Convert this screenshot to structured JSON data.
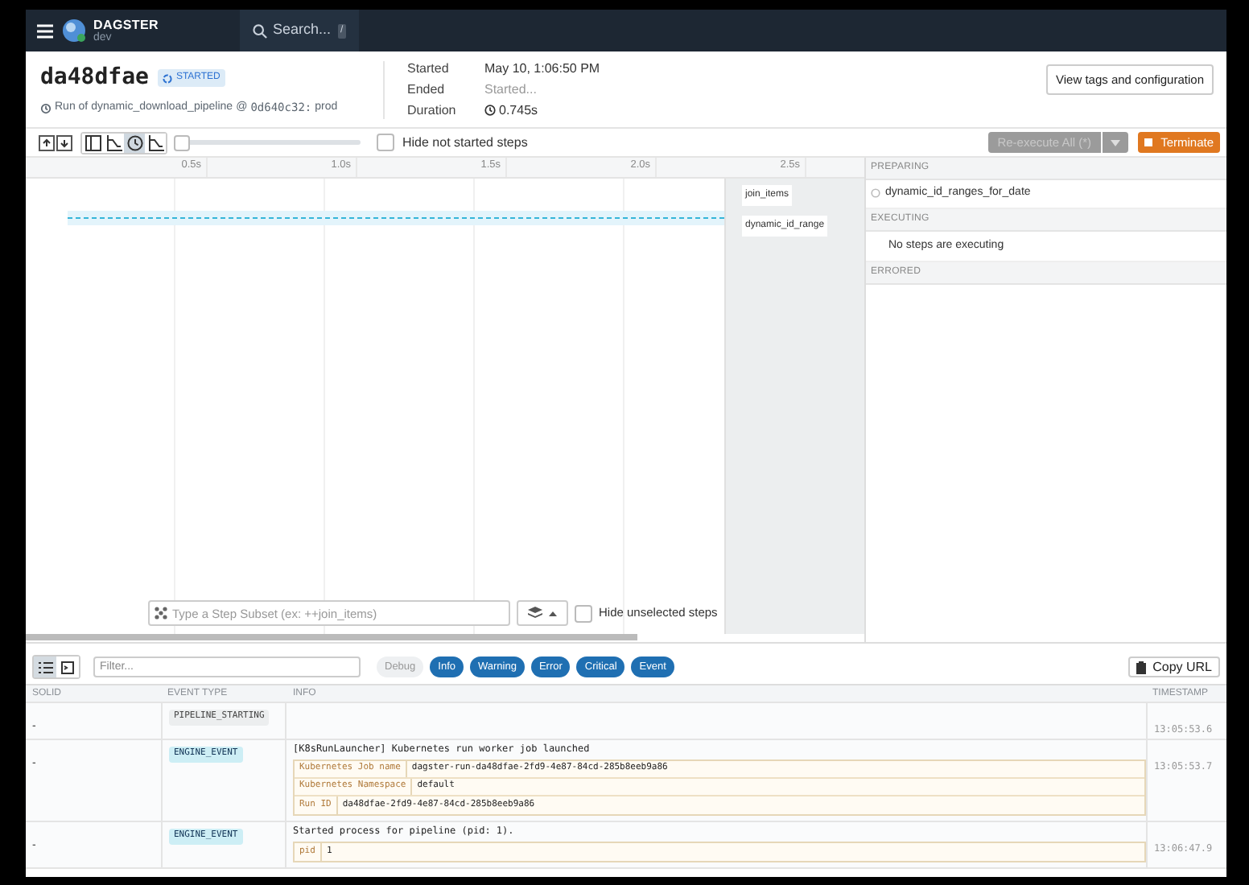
{
  "topbar": {
    "brand": "DAGSTER",
    "env": "dev",
    "search_placeholder": "Search...",
    "search_key": "/"
  },
  "run": {
    "id": "da48dfae",
    "status": "STARTED",
    "prefix": "Run of",
    "pipeline": "dynamic_download_pipeline",
    "at": "@",
    "snapshot": "0d640c32:",
    "mode": "prod"
  },
  "times": [
    {
      "label": "Started",
      "value": "May 10, 1:06:50 PM",
      "kind": "text"
    },
    {
      "label": "Ended",
      "value": "Started...",
      "kind": "muted"
    },
    {
      "label": "Duration",
      "value": "0.745s",
      "kind": "clock"
    }
  ],
  "view_button": "View tags and configuration",
  "toolbar": {
    "view_modes": [
      {
        "kind": "flat",
        "selected": false
      },
      {
        "kind": "waterfall",
        "selected": false
      },
      {
        "kind": "clock",
        "selected": true
      },
      {
        "kind": "waterfall",
        "selected": false
      }
    ],
    "zoom": {
      "level": 0.02
    },
    "hide_not_started": {
      "label": "Hide not started steps",
      "checked": false
    },
    "reexecute": {
      "label": "Re-execute All (*)",
      "disabled": true
    },
    "terminate": "Terminate"
  },
  "gantt": {
    "ticks": [
      "0.5s",
      "1.0s",
      "1.5s",
      "2.0s",
      "2.5s"
    ],
    "steps": [
      "join_items",
      "dynamic_id_range"
    ],
    "subset_placeholder": "Type a Step Subset (ex: ++join_items)",
    "hide_unselected": {
      "label": "Hide unselected steps",
      "checked": false
    }
  },
  "sections": [
    {
      "title": "PREPARING",
      "items": [
        "dynamic_id_ranges_for_date"
      ]
    },
    {
      "title": "EXECUTING",
      "empty": "No steps are executing"
    },
    {
      "title": "ERRORED"
    }
  ],
  "logs": {
    "filter_placeholder": "Filter...",
    "levels": [
      {
        "label": "Debug",
        "selected": false
      },
      {
        "label": "Info",
        "selected": true
      },
      {
        "label": "Warning",
        "selected": true
      },
      {
        "label": "Error",
        "selected": true
      },
      {
        "label": "Critical",
        "selected": true
      },
      {
        "label": "Event",
        "selected": true
      }
    ],
    "copy_url": "Copy URL",
    "columns": [
      "SOLID",
      "EVENT TYPE",
      "INFO",
      "TIMESTAMP"
    ],
    "rows": [
      {
        "solid": "-",
        "event": "PIPELINE_STARTING",
        "kind": "pipeline",
        "timestamp": "13:05:53.6"
      },
      {
        "solid": "-",
        "event": "ENGINE_EVENT",
        "kind": "engine",
        "message": "[K8sRunLauncher] Kubernetes run worker job launched",
        "metadata": [
          {
            "key": "Kubernetes Job name",
            "value": "dagster-run-da48dfae-2fd9-4e87-84cd-285b8eeb9a86"
          },
          {
            "key": "Kubernetes Namespace",
            "value": "default"
          },
          {
            "key": "Run ID",
            "value": "da48dfae-2fd9-4e87-84cd-285b8eeb9a86"
          }
        ],
        "timestamp": "13:05:53.7"
      },
      {
        "solid": "-",
        "event": "ENGINE_EVENT",
        "kind": "engine",
        "message": "Started process for pipeline (pid: 1).",
        "metadata": [
          {
            "key": "pid",
            "value": "1"
          }
        ],
        "timestamp": "13:06:47.9"
      }
    ]
  }
}
